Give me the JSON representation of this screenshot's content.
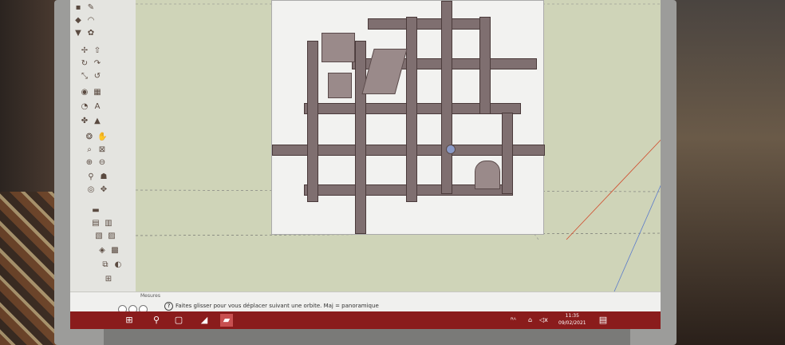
{
  "status_bar": {
    "tab_label": "Mesures",
    "help_icon": "?",
    "message": "Faites glisser pour vous déplacer suivant une orbite. Maj = panoramique"
  },
  "taskbar": {
    "start_icon": "windows-icon",
    "search_icon": "search-icon",
    "task_view_icon": "task-view-icon",
    "app_icon": "sketchup-icon",
    "tray": {
      "people": "ᴿᴬ",
      "network": "⌂",
      "volume": "◁x"
    },
    "time": "11:35",
    "date": "09/02/2021"
  },
  "colors": {
    "taskbar": "#8a1c1c",
    "canvas": "#cfd4b8",
    "street": "#7f6f70"
  }
}
